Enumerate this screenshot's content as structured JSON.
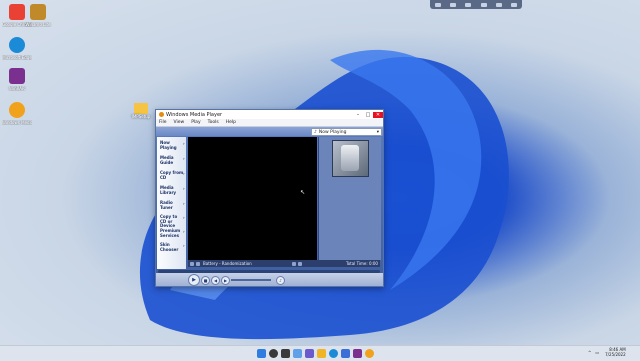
{
  "desktop": {
    "icons": [
      {
        "label": "Google Chrome",
        "color": "#e94235"
      },
      {
        "label": "Winamp Lite",
        "color": "#c08a2a"
      },
      {
        "label": "Microsoft Edge",
        "color": "#1b8bd8"
      },
      {
        "label": "WinRAR",
        "color": "#7b2f8e"
      },
      {
        "label": "Windows Media Player",
        "color": "#f1a21c"
      }
    ],
    "folder_label": "IMPSetup"
  },
  "wmp": {
    "title": "Windows Media Player",
    "menu": [
      "File",
      "View",
      "Play",
      "Tools",
      "Help"
    ],
    "now_playing_select": "Now Playing",
    "tasks": [
      "Now Playing",
      "Media Guide",
      "Copy from CD",
      "Media Library",
      "Radio Tuner",
      "Copy to CD or Device",
      "Premium Services",
      "Skin Chooser"
    ],
    "status_title": "Battery - Randomization",
    "total_time": "Total Time: 0:00"
  },
  "taskbar": {
    "clock_time": "8:46 AM",
    "clock_date": "7/25/2022",
    "apps": [
      {
        "name": "start",
        "color": "#2f7de1"
      },
      {
        "name": "search",
        "color": "#3a3a3a"
      },
      {
        "name": "task-view",
        "color": "#3a3a3a"
      },
      {
        "name": "widgets",
        "color": "#5fa0e8"
      },
      {
        "name": "chat",
        "color": "#6a5acd"
      },
      {
        "name": "file-explorer",
        "color": "#f0b429"
      },
      {
        "name": "edge",
        "color": "#1b8bd8"
      },
      {
        "name": "store",
        "color": "#3a6fd8"
      },
      {
        "name": "winrar",
        "color": "#7b2f8e"
      },
      {
        "name": "media-player",
        "color": "#f1a21c"
      }
    ]
  }
}
